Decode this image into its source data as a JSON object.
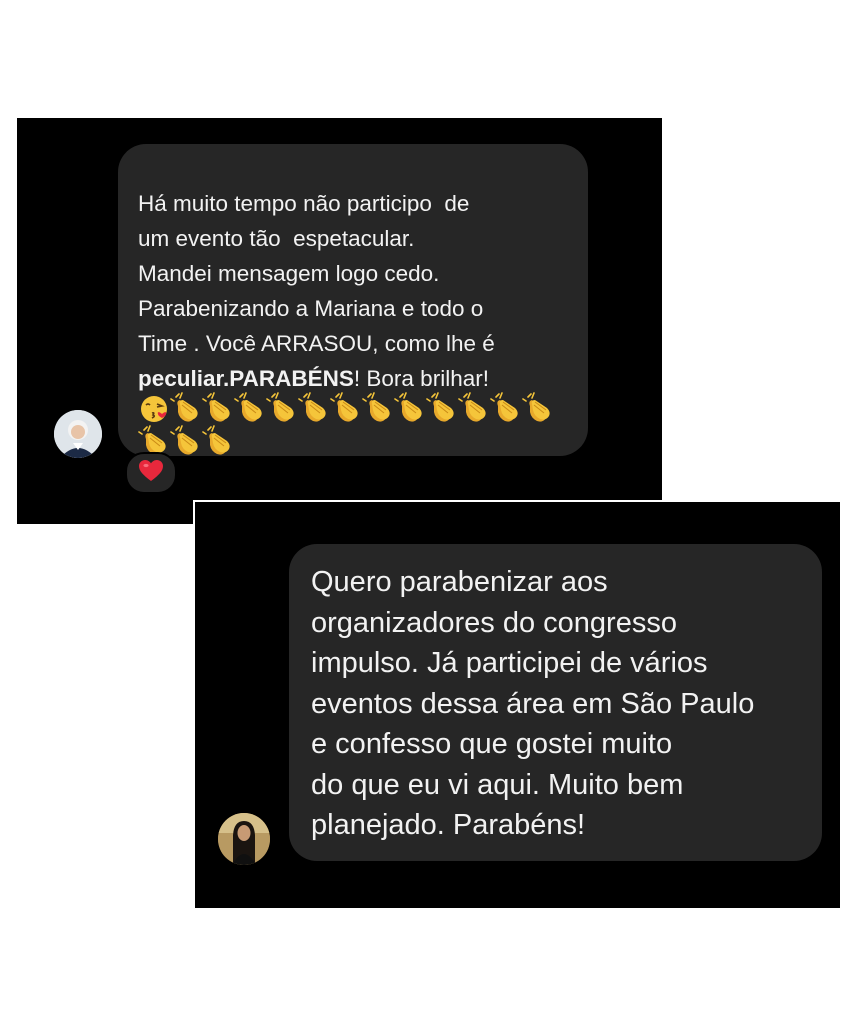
{
  "comment1": {
    "lines": [
      "Há muito tempo não participo  de",
      "um evento tão  espetacular.",
      "Mandei mensagem logo cedo.",
      "Parabenizando a Mariana e todo o",
      "Time . Você ARRASOU, como lhe é"
    ],
    "last_bold": "peculiar.PARABÉNS",
    "last_rest": "! Bora brilhar!",
    "emojis_row1": [
      "kissing-face-emoji",
      "clapping-hands-emoji",
      "clapping-hands-emoji",
      "clapping-hands-emoji",
      "clapping-hands-emoji",
      "clapping-hands-emoji",
      "clapping-hands-emoji",
      "clapping-hands-emoji",
      "clapping-hands-emoji",
      "clapping-hands-emoji",
      "clapping-hands-emoji",
      "clapping-hands-emoji",
      "clapping-hands-emoji"
    ],
    "emojis_row2": [
      "clapping-hands-emoji",
      "clapping-hands-emoji",
      "clapping-hands-emoji"
    ],
    "reaction": "heart-icon",
    "avatar": "avatar-older-woman"
  },
  "comment2": {
    "lines": [
      "Quero parabenizar aos",
      "organizadores do congresso",
      "impulso. Já participei de vários",
      "eventos dessa área em São Paulo",
      "e confesso que gostei muito",
      "do que eu vi aqui. Muito bem",
      "planejado. Parabéns!"
    ],
    "avatar": "avatar-woman-dark-hair"
  },
  "colors": {
    "background": "#000000",
    "bubble": "#262626",
    "text": "#f2f2f2",
    "heart": "#e8283c",
    "emoji_yellow": "#f5c53a"
  }
}
